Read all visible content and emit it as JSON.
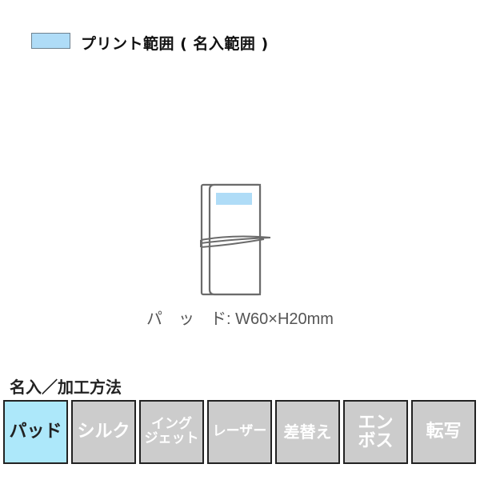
{
  "legend": {
    "label": "プリント範囲 ( 名入範囲 )",
    "swatch_color": "#afdcf7"
  },
  "product": {
    "name": "pad-notebook-with-band",
    "print_area_color": "#afdcf7"
  },
  "size_label": "パ　ッ　ド: W60×H20mm",
  "section_title": "名入／加工方法",
  "methods": [
    {
      "label": "パッド",
      "active": true
    },
    {
      "label": "シルク",
      "active": false
    },
    {
      "label": "イング\nジェット",
      "active": false
    },
    {
      "label": "レーザー",
      "active": false
    },
    {
      "label": "差替え",
      "active": false
    },
    {
      "label": "エン\nボス",
      "active": false
    },
    {
      "label": "転写",
      "active": false
    }
  ],
  "colors": {
    "active": "#ade8fa",
    "inactive": "#cccccc",
    "border": "#222222"
  }
}
